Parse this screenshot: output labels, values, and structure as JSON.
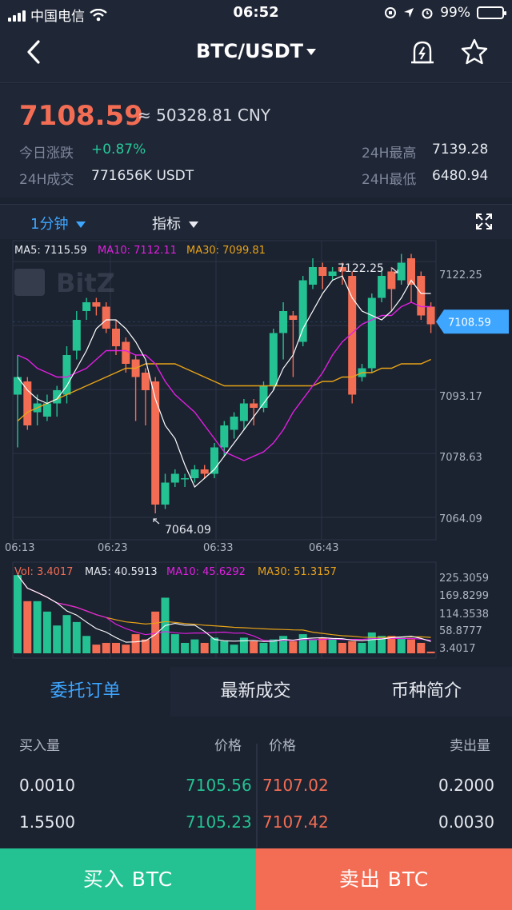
{
  "status_bar": {
    "carrier": "中国电信",
    "time": "06:52",
    "battery": "99%"
  },
  "nav": {
    "title": "BTC/USDT"
  },
  "ticker": {
    "last_price": "7108.59",
    "cny_price": "≈ 50328.81 CNY",
    "change_label": "今日涨跌",
    "change_value": "+0.87%",
    "volume_label": "24H成交",
    "volume_value": "771656K USDT",
    "high_label": "24H最高",
    "high_value": "7139.28",
    "low_label": "24H最低",
    "low_value": "6480.94"
  },
  "chart_toolbar": {
    "interval": "1分钟",
    "indicator": "指标"
  },
  "colors": {
    "up": "#24c292",
    "down": "#f26d54",
    "ma5": "#ffffff",
    "ma10": "#e020e0",
    "ma30": "#e8a317",
    "accent": "#3ea6ff"
  },
  "chart_data": {
    "type": "candlestick",
    "legend_main": {
      "ma5": "MA5: 7115.59",
      "ma10": "MA10: 7112.11",
      "ma30": "MA30: 7099.81"
    },
    "legend_vol": {
      "vol": "Vol: 3.4017",
      "ma5": "MA5: 40.5913",
      "ma10": "MA10: 45.6292",
      "ma30": "MA30: 51.3157"
    },
    "watermark": "BitZ",
    "price_axis": [
      "7122.25",
      "7093.17",
      "7078.63",
      "7064.09"
    ],
    "volume_axis": [
      "225.3059",
      "169.8299",
      "114.3538",
      "58.8777",
      "3.4017"
    ],
    "time_axis": [
      "06:13",
      "06:23",
      "06:33",
      "06:43"
    ],
    "current_price_tag": "7108.59",
    "max_label": "7122.25",
    "min_label": "7064.09",
    "candles": [
      {
        "o": 7092,
        "c": 7096,
        "h": 7101,
        "l": 7080,
        "v": 225
      },
      {
        "o": 7095,
        "c": 7085,
        "h": 7096,
        "l": 7084,
        "v": 150
      },
      {
        "o": 7088,
        "c": 7090,
        "h": 7092,
        "l": 7085,
        "v": 150
      },
      {
        "o": 7087,
        "c": 7090,
        "h": 7092,
        "l": 7086,
        "v": 120
      },
      {
        "o": 7090,
        "c": 7093,
        "h": 7094,
        "l": 7087,
        "v": 80
      },
      {
        "o": 7092,
        "c": 7101,
        "h": 7103,
        "l": 7090,
        "v": 110
      },
      {
        "o": 7102,
        "c": 7109,
        "h": 7111,
        "l": 7100,
        "v": 90
      },
      {
        "o": 7111,
        "c": 7113,
        "h": 7114,
        "l": 7109,
        "v": 50
      },
      {
        "o": 7113,
        "c": 7112,
        "h": 7114,
        "l": 7110,
        "v": 25
      },
      {
        "o": 7112,
        "c": 7107,
        "h": 7113,
        "l": 7106,
        "v": 30
      },
      {
        "o": 7107,
        "c": 7103,
        "h": 7109,
        "l": 7101,
        "v": 30
      },
      {
        "o": 7104,
        "c": 7099,
        "h": 7105,
        "l": 7097,
        "v": 25
      },
      {
        "o": 7100,
        "c": 7096,
        "h": 7101,
        "l": 7086,
        "v": 55
      },
      {
        "o": 7097,
        "c": 7093,
        "h": 7098,
        "l": 7085,
        "v": 40
      },
      {
        "o": 7095,
        "c": 7067,
        "h": 7096,
        "l": 7065,
        "v": 120
      },
      {
        "o": 7067,
        "c": 7072,
        "h": 7074,
        "l": 7066,
        "v": 160
      },
      {
        "o": 7072,
        "c": 7074,
        "h": 7075,
        "l": 7071,
        "v": 55
      },
      {
        "o": 7073,
        "c": 7073,
        "h": 7074,
        "l": 7071,
        "v": 30
      },
      {
        "o": 7073,
        "c": 7075,
        "h": 7076,
        "l": 7072,
        "v": 40
      },
      {
        "o": 7075,
        "c": 7074,
        "h": 7076,
        "l": 7073,
        "v": 30
      },
      {
        "o": 7074,
        "c": 7080,
        "h": 7081,
        "l": 7073,
        "v": 45
      },
      {
        "o": 7080,
        "c": 7085,
        "h": 7086,
        "l": 7078,
        "v": 35
      },
      {
        "o": 7084,
        "c": 7087,
        "h": 7088,
        "l": 7082,
        "v": 25
      },
      {
        "o": 7086,
        "c": 7090,
        "h": 7091,
        "l": 7084,
        "v": 45
      },
      {
        "o": 7090,
        "c": 7089,
        "h": 7091,
        "l": 7085,
        "v": 35
      },
      {
        "o": 7089,
        "c": 7094,
        "h": 7095,
        "l": 7088,
        "v": 30
      },
      {
        "o": 7094,
        "c": 7106,
        "h": 7107,
        "l": 7093,
        "v": 40
      },
      {
        "o": 7106,
        "c": 7111,
        "h": 7113,
        "l": 7100,
        "v": 50
      },
      {
        "o": 7110,
        "c": 7109,
        "h": 7111,
        "l": 7096,
        "v": 35
      },
      {
        "o": 7104,
        "c": 7118,
        "h": 7119,
        "l": 7103,
        "v": 55
      },
      {
        "o": 7117,
        "c": 7121,
        "h": 7123,
        "l": 7116,
        "v": 40
      },
      {
        "o": 7121,
        "c": 7119,
        "h": 7122,
        "l": 7116,
        "v": 45
      },
      {
        "o": 7119,
        "c": 7120,
        "h": 7121,
        "l": 7118,
        "v": 40
      },
      {
        "o": 7121,
        "c": 7120,
        "h": 7122,
        "l": 7117,
        "v": 30
      },
      {
        "o": 7119,
        "c": 7092,
        "h": 7120,
        "l": 7090,
        "v": 35
      },
      {
        "o": 7096,
        "c": 7098,
        "h": 7099,
        "l": 7095,
        "v": 30
      },
      {
        "o": 7098,
        "c": 7114,
        "h": 7115,
        "l": 7097,
        "v": 60
      },
      {
        "o": 7114,
        "c": 7119,
        "h": 7121,
        "l": 7113,
        "v": 50
      },
      {
        "o": 7120,
        "c": 7116,
        "h": 7121,
        "l": 7111,
        "v": 50
      },
      {
        "o": 7118,
        "c": 7122,
        "h": 7124,
        "l": 7117,
        "v": 45
      },
      {
        "o": 7123,
        "c": 7117,
        "h": 7124,
        "l": 7113,
        "v": 40
      },
      {
        "o": 7119,
        "c": 7110,
        "h": 7120,
        "l": 7109,
        "v": 30
      },
      {
        "o": 7112,
        "c": 7108,
        "h": 7113,
        "l": 7106,
        "v": 5
      }
    ],
    "ma5": [
      7096,
      7093,
      7091,
      7090,
      7091,
      7094,
      7098,
      7102,
      7107,
      7109,
      7109,
      7107,
      7104,
      7100,
      7091,
      7085,
      7082,
      7076,
      7071,
      7073,
      7075,
      7078,
      7081,
      7084,
      7087,
      7090,
      7093,
      7098,
      7101,
      7107,
      7111,
      7115,
      7118,
      7119,
      7114,
      7111,
      7110,
      7109,
      7111,
      7114,
      7118,
      7115,
      7115
    ],
    "ma10": [
      7101,
      7100,
      7098,
      7097,
      7096,
      7096,
      7097,
      7098,
      7100,
      7102,
      7102,
      7102,
      7101,
      7101,
      7099,
      7095,
      7092,
      7090,
      7088,
      7085,
      7082,
      7079,
      7078,
      7077,
      7078,
      7079,
      7081,
      7084,
      7088,
      7091,
      7094,
      7097,
      7101,
      7104,
      7106,
      7108,
      7109,
      7110,
      7110,
      7112,
      7113,
      7112,
      7112
    ],
    "ma30": [
      7086,
      7088,
      7089,
      7090,
      7091,
      7092,
      7093,
      7094,
      7095,
      7096,
      7097,
      7098,
      7098,
      7099,
      7099,
      7099,
      7099,
      7098,
      7097,
      7096,
      7095,
      7094,
      7094,
      7094,
      7094,
      7094,
      7094,
      7094,
      7094,
      7094,
      7094,
      7095,
      7095,
      7096,
      7096,
      7097,
      7097,
      7098,
      7098,
      7099,
      7099,
      7099,
      7100
    ]
  },
  "order_tabs": [
    "委托订单",
    "最新成交",
    "币种简介"
  ],
  "order_book": {
    "headers": {
      "buy_qty": "买入量",
      "buy_price": "价格",
      "sell_price": "价格",
      "sell_qty": "卖出量"
    },
    "rows": [
      {
        "buy_qty": "0.0010",
        "buy_price": "7105.56",
        "sell_price": "7107.02",
        "sell_qty": "0.2000"
      },
      {
        "buy_qty": "1.5500",
        "buy_price": "7105.23",
        "sell_price": "7107.42",
        "sell_qty": "0.0030"
      }
    ]
  },
  "actions": {
    "buy": "买入 BTC",
    "sell": "卖出 BTC"
  }
}
